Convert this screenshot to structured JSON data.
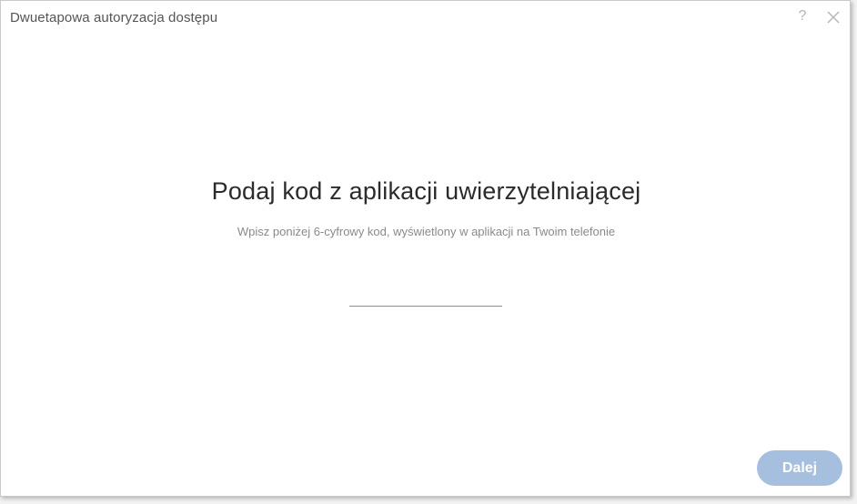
{
  "dialog": {
    "title": "Dwuetapowa autoryzacja dostępu",
    "help_glyph": "?",
    "heading": "Podaj kod z aplikacji uwierzytelniającej",
    "subheading": "Wpisz poniżej 6-cyfrowy kod, wyświetlony w aplikacji na Twoim telefonie",
    "code_input": {
      "value": "",
      "placeholder": ""
    },
    "next_label": "Dalej"
  },
  "icons": {
    "help": "help-icon",
    "close": "close-icon"
  },
  "colors": {
    "button_disabled": "#a6bfdf",
    "heading_text": "#2b2b2b",
    "muted_text": "#8a8a8a"
  }
}
